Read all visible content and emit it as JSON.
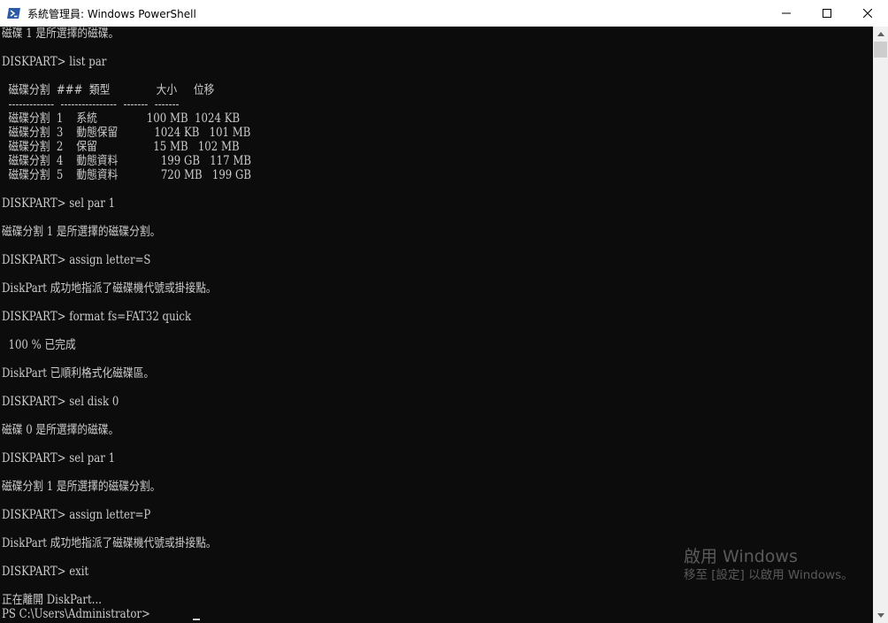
{
  "window": {
    "title": "系統管理員: Windows PowerShell",
    "app_icon": "powershell-icon",
    "controls": {
      "minimize_icon": "minimize-icon",
      "maximize_icon": "maximize-icon",
      "close_icon": "close-icon"
    }
  },
  "console": {
    "lines": [
      "磁碟 1 是所選擇的磁碟。",
      "",
      "DISKPART> list par",
      "",
      "  磁碟分割  ###  類型              大小     位移",
      "  -------------  ----------------  -------  -------",
      "  磁碟分割  1    系統               100 MB  1024 KB",
      "  磁碟分割  3    動態保留           1024 KB   101 MB",
      "  磁碟分割  2    保留                 15 MB   102 MB",
      "  磁碟分割  4    動態資料             199 GB   117 MB",
      "  磁碟分割  5    動態資料             720 MB   199 GB",
      "",
      "DISKPART> sel par 1",
      "",
      "磁碟分割 1 是所選擇的磁碟分割。",
      "",
      "DISKPART> assign letter=S",
      "",
      "DiskPart 成功地指派了磁碟機代號或掛接點。",
      "",
      "DISKPART> format fs=FAT32 quick",
      "",
      "  100 % 已完成",
      "",
      "DiskPart 已順利格式化磁碟區。",
      "",
      "DISKPART> sel disk 0",
      "",
      "磁碟 0 是所選擇的磁碟。",
      "",
      "DISKPART> sel par 1",
      "",
      "磁碟分割 1 是所選擇的磁碟分割。",
      "",
      "DISKPART> assign letter=P",
      "",
      "DiskPart 成功地指派了磁碟機代號或掛接點。",
      "",
      "DISKPART> exit",
      "",
      "正在離開 DiskPart...",
      "PS C:\\Users\\Administrator> "
    ]
  },
  "watermark": {
    "title": "啟用 Windows",
    "subtitle": "移至 [設定] 以啟用 Windows。"
  },
  "scrollbar": {
    "up_icon": "scroll-up-arrow-icon",
    "down_icon": "scroll-down-arrow-icon"
  },
  "colors": {
    "console_bg": "#0c0c0c",
    "console_fg": "#cccccc",
    "titlebar_bg": "#ffffff",
    "icon_blue": "#2a5aa8"
  }
}
